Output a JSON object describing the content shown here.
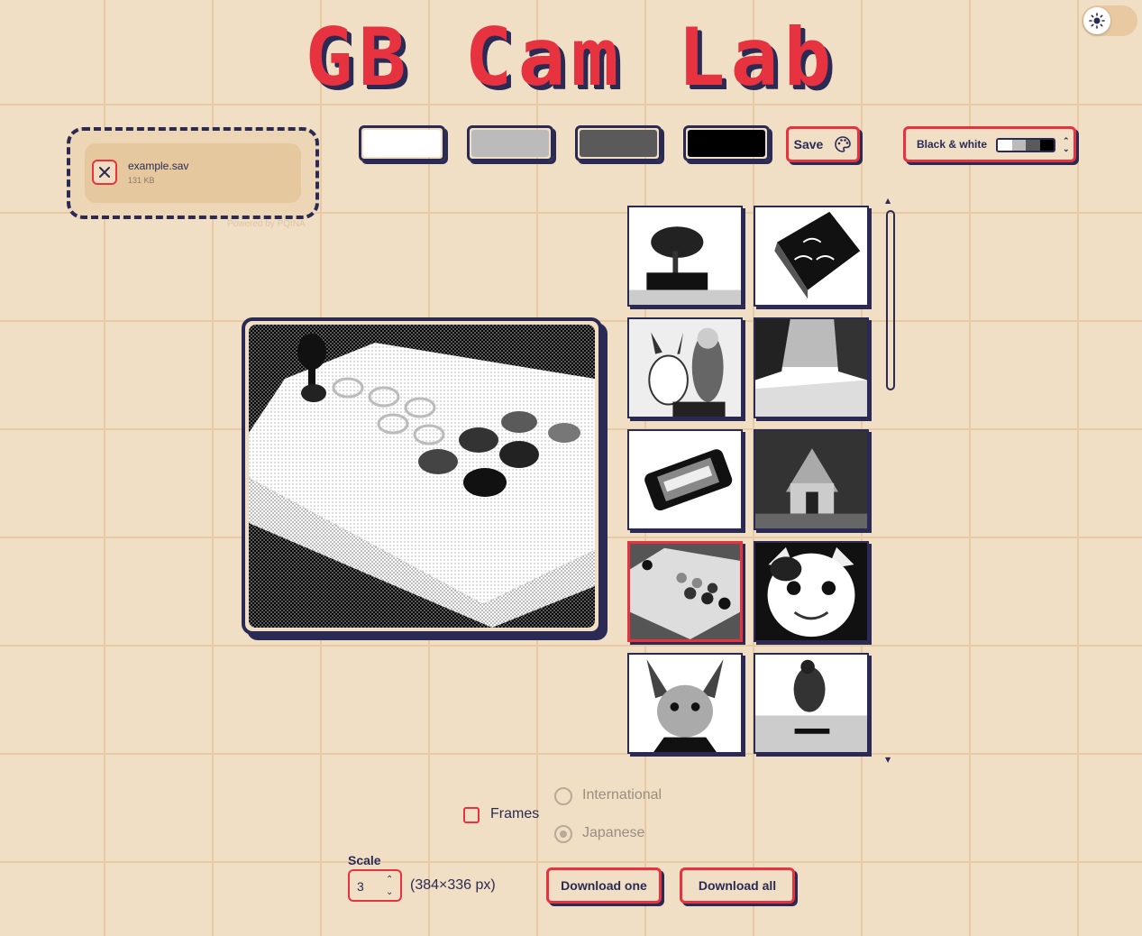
{
  "app": {
    "title": "GB Cam Lab"
  },
  "theme_toggle": {
    "icon": "sun-icon"
  },
  "file_upload": {
    "file_name": "example.sav",
    "file_size": "131 KB",
    "powered_by": "Powered by PQINA"
  },
  "palette": {
    "swatches": [
      {
        "name": "lightest",
        "color": "#ffffff"
      },
      {
        "name": "light",
        "color": "#bbbbbb"
      },
      {
        "name": "dark",
        "color": "#5a5a5a"
      },
      {
        "name": "darkest",
        "color": "#000000"
      }
    ],
    "save_label": "Save",
    "selected_palette": "Black & white",
    "preview_colors": [
      "#ffffff",
      "#bbbbbb",
      "#5a5a5a",
      "#000000"
    ]
  },
  "gallery": {
    "selected_index": 6,
    "thumbnails": [
      "bonsai-tree",
      "ornate-book",
      "pikachu-figure",
      "snowy-road",
      "nintendo-switch",
      "miniature-house",
      "arcade-controller",
      "smiling-cat",
      "caracal",
      "skateboarder"
    ]
  },
  "options": {
    "frames_label": "Frames",
    "frames_checked": false,
    "frame_types": [
      "International",
      "Japanese"
    ],
    "selected_frame_type": "Japanese"
  },
  "scale": {
    "label": "Scale",
    "value": "3",
    "dimensions": "(384×336 px)"
  },
  "actions": {
    "download_one": "Download one",
    "download_all": "Download all"
  },
  "colors": {
    "accent": "#e7323f",
    "ink": "#2a2a55",
    "background": "#f0dfc5"
  }
}
